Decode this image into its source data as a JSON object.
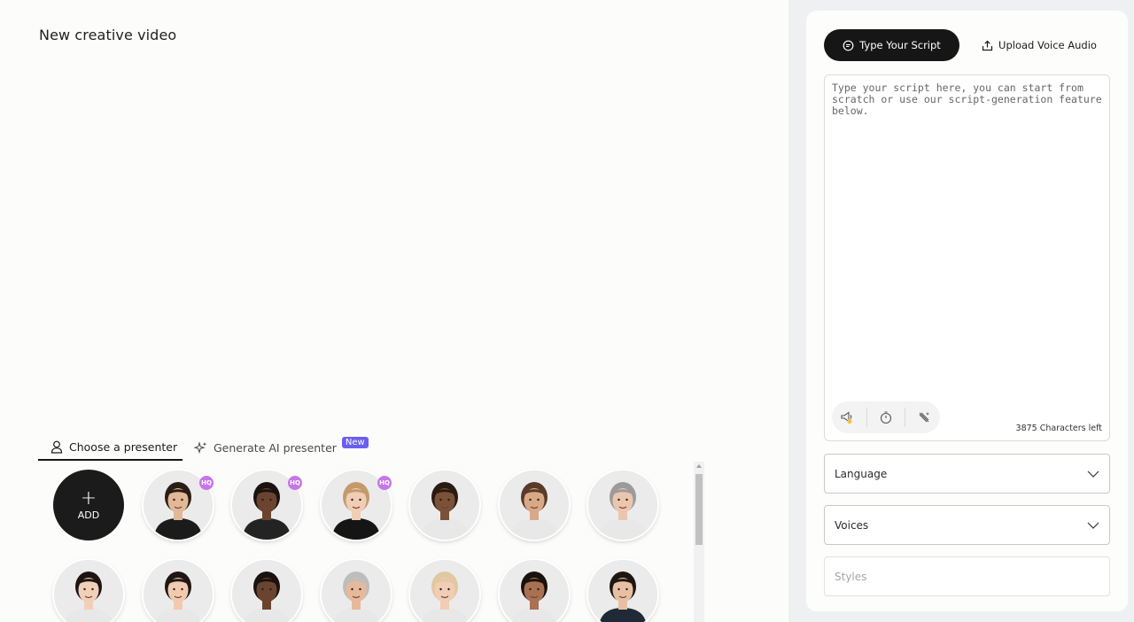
{
  "page": {
    "title": "New creative video"
  },
  "presenter_tabs": {
    "choose": "Choose a presenter",
    "generate": "Generate AI presenter",
    "new_badge": "New"
  },
  "presenters": {
    "add_label": "ADD",
    "add_plus": "+",
    "hq_label": "HQ",
    "items": [
      {
        "id": "p1",
        "hq": true,
        "skin": "#e2b896",
        "hair": "#2a1d16",
        "shirt": "#1b1b1b"
      },
      {
        "id": "p2",
        "hq": true,
        "skin": "#6b4430",
        "hair": "#1a120e",
        "shirt": "#232323"
      },
      {
        "id": "p3",
        "hq": true,
        "skin": "#f0cdb4",
        "hair": "#c59a6a",
        "shirt": "#151515"
      },
      {
        "id": "p4",
        "hq": false,
        "skin": "#7b5137",
        "hair": "#2a1b12",
        "shirt": "#e8e8e8"
      },
      {
        "id": "p5",
        "hq": false,
        "skin": "#d9a987",
        "hair": "#5a3b28",
        "shirt": "#e8e8e8"
      },
      {
        "id": "p6",
        "hq": false,
        "skin": "#ebc6ad",
        "hair": "#9b9b9b",
        "shirt": "#e8e8e8"
      },
      {
        "id": "p7",
        "hq": false,
        "skin": "#f2cfb8",
        "hair": "#1c1512",
        "shirt": "#e8e8e8"
      },
      {
        "id": "p8",
        "hq": false,
        "skin": "#f1cab0",
        "hair": "#1e1714",
        "shirt": "#e8e8e8"
      },
      {
        "id": "p9",
        "hq": false,
        "skin": "#6b4430",
        "hair": "#1a120e",
        "shirt": "#e8e8e8"
      },
      {
        "id": "p10",
        "hq": false,
        "skin": "#e6b99b",
        "hair": "#bdbdbd",
        "shirt": "#e8e8e8"
      },
      {
        "id": "p11",
        "hq": false,
        "skin": "#f0cdb4",
        "hair": "#e0c9a0",
        "shirt": "#e8e8e8"
      },
      {
        "id": "p12",
        "hq": false,
        "skin": "#a87152",
        "hair": "#1a120e",
        "shirt": "#e8e8e8"
      },
      {
        "id": "p13",
        "hq": false,
        "skin": "#e7c0a3",
        "hair": "#1d1612",
        "shirt": "#1f2a36"
      }
    ]
  },
  "script_panel": {
    "tab_type": "Type Your Script",
    "tab_upload": "Upload Voice Audio",
    "placeholder": "Type your script here, you can start from scratch or use our script-generation feature below.",
    "chars_left": "3875 Characters left",
    "tools": [
      "megaphone-icon",
      "timer-icon",
      "magic-wand-icon"
    ]
  },
  "selects": {
    "language": "Language",
    "voices": "Voices",
    "styles": "Styles"
  },
  "colors": {
    "accent_badge": "#6a5ef0",
    "hq_badge": "#c776e8",
    "dark_button": "#161616",
    "sidebar_bg": "#eff0f2"
  }
}
